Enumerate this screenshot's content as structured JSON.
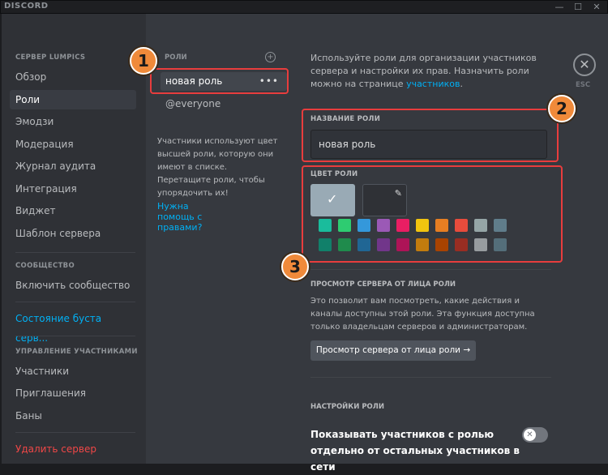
{
  "app": {
    "title": "DISCORD"
  },
  "window": {
    "minimize": "—",
    "maximize": "☐",
    "close": "✕"
  },
  "sidebar": {
    "server_header": "СЕРВЕР LUMPICS",
    "items": [
      "Обзор",
      "Роли",
      "Эмодзи",
      "Модерация",
      "Журнал аудита",
      "Интеграция",
      "Виджет",
      "Шаблон сервера"
    ],
    "community_header": "СООБЩЕСТВО",
    "community_items": [
      "Включить сообщество"
    ],
    "boost": "Состояние буста серв...",
    "members_header": "УПРАВЛЕНИЕ УЧАСТНИКАМИ",
    "member_items": [
      "Участники",
      "Приглашения",
      "Баны"
    ],
    "delete": "Удалить сервер"
  },
  "roles": {
    "header": "РОЛИ",
    "list": [
      "новая роль",
      "@everyone"
    ],
    "description": "Участники используют цвет высшей роли, которую они имеют в списке. Перетащите роли, чтобы упорядочить их!",
    "help_link": "Нужна помощь с правами?"
  },
  "settings": {
    "intro": "Используйте роли для организации участников сервера и настройки их прав. Назначить роли можно на странице",
    "intro_link": "участников",
    "intro_end": ".",
    "name_label": "НАЗВАНИЕ РОЛИ",
    "name_value": "новая роль",
    "color_label": "ЦВЕТ РОЛИ",
    "colors_row1": [
      "#1abc9c",
      "#2ecc71",
      "#3498db",
      "#9b59b6",
      "#e91e63",
      "#f1c40f",
      "#e67e22",
      "#e74c3c",
      "#95a5a6",
      "#607d8b"
    ],
    "colors_row2": [
      "#11806a",
      "#1f8b4c",
      "#206694",
      "#71368a",
      "#ad1457",
      "#c27c0e",
      "#a84300",
      "#992d22",
      "#979c9f",
      "#546e7a"
    ],
    "view_header": "ПРОСМОТР СЕРВЕРА ОТ ЛИЦА РОЛИ",
    "view_desc": "Это позволит вам посмотреть, какие действия и каналы доступны этой роли. Эта функция доступна только владельцам серверов и администраторам.",
    "view_button": "Просмотр сервера от лица роли →",
    "role_settings_header": "НАСТРОЙКИ РОЛИ",
    "toggle_label": "Показывать участников с ролью отдельно от остальных участников в сети",
    "close_label": "ESC"
  },
  "annotations": [
    "1",
    "2",
    "3"
  ]
}
